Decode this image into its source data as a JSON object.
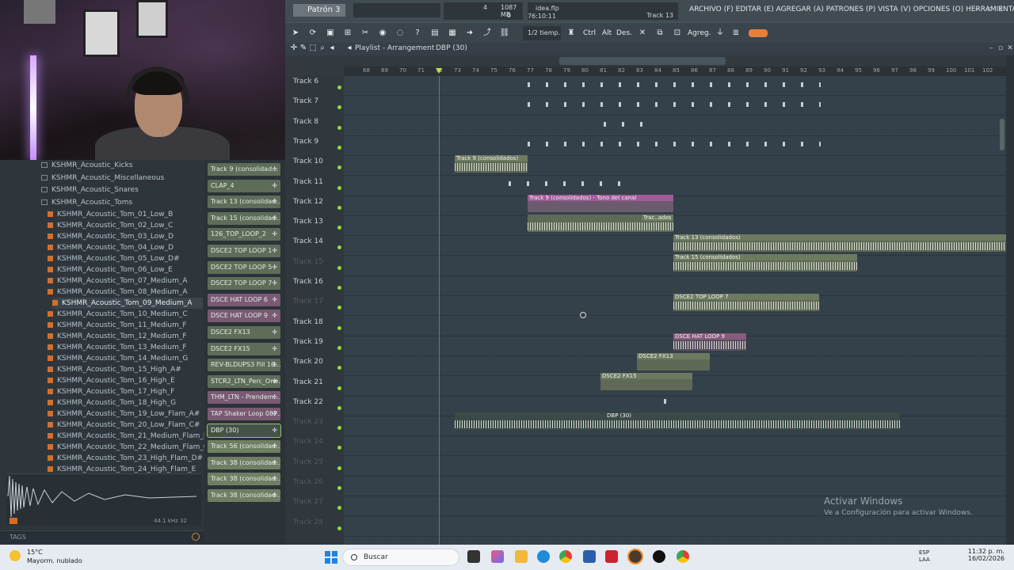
{
  "top": {
    "pattern": "Patrón 3",
    "cpu_num": "4",
    "mem": "1087 MB",
    "poly": "0",
    "hint_title": "idea.flp",
    "hint_time": "76:10:11",
    "hint_track": "Track 13",
    "menu": "ARCHIVO (F) EDITAR (E) AGREGAR (A) PATRONES (P) VISTA (V) OPCIONES (O) HERRAMIENTAS (T) AYUDA"
  },
  "toolbar": {
    "snap": "1/2 tiemp.",
    "ctrl": "Ctrl",
    "alt": "Alt",
    "des": "Des.",
    "agreg": "Agreg."
  },
  "playlist": {
    "title": "Playlist - Arrangement",
    "crumb": "DBP (30)"
  },
  "ruler": [
    "68",
    "69",
    "70",
    "71",
    "72",
    "73",
    "74",
    "75",
    "76",
    "77",
    "78",
    "79",
    "80",
    "81",
    "82",
    "83",
    "84",
    "85",
    "86",
    "87",
    "88",
    "89",
    "90",
    "91",
    "92",
    "93",
    "94",
    "95",
    "96",
    "97",
    "98",
    "99",
    "100",
    "101",
    "102"
  ],
  "tracks": [
    {
      "name": "Track 6",
      "dim": false
    },
    {
      "name": "Track 7",
      "dim": false
    },
    {
      "name": "Track 8",
      "dim": false
    },
    {
      "name": "Track 9",
      "dim": false
    },
    {
      "name": "Track 10",
      "dim": false
    },
    {
      "name": "Track 11",
      "dim": false
    },
    {
      "name": "Track 12",
      "dim": false
    },
    {
      "name": "Track 13",
      "dim": false
    },
    {
      "name": "Track 14",
      "dim": false
    },
    {
      "name": "Track 15",
      "dim": true
    },
    {
      "name": "Track 16",
      "dim": false
    },
    {
      "name": "Track 17",
      "dim": true
    },
    {
      "name": "Track 18",
      "dim": false
    },
    {
      "name": "Track 19",
      "dim": false
    },
    {
      "name": "Track 20",
      "dim": false
    },
    {
      "name": "Track 21",
      "dim": false
    },
    {
      "name": "Track 22",
      "dim": false
    },
    {
      "name": "Track 23",
      "dim": true
    },
    {
      "name": "Track 24",
      "dim": true
    },
    {
      "name": "Track 25",
      "dim": true
    },
    {
      "name": "Track 26",
      "dim": true
    },
    {
      "name": "Track 27",
      "dim": true
    },
    {
      "name": "Track 28",
      "dim": true
    }
  ],
  "clips": {
    "t9": "Track 9 (consolidados)",
    "t11": "Track 9 (consolidados) - Tono del canal",
    "t12": "Trac..ados",
    "t13": "Track 13 (consolidados)",
    "t14": "Track 15 (consolidados)",
    "t16": "DSCE2 TOP LOOP 7",
    "t18": "DSCE HAT LOOP 9",
    "t19": "DSCE2 FX13",
    "t20": "DSCE2 FX15",
    "t22": "DBP (30)"
  },
  "browser": {
    "folders": [
      "KSHMR_Acoustic_Kicks",
      "KSHMR_Acoustic_Miscellaneous",
      "KSHMR_Acoustic_Snares",
      "KSHMR_Acoustic_Toms"
    ],
    "files": [
      "KSHMR_Acoustic_Tom_01_Low_B",
      "KSHMR_Acoustic_Tom_02_Low_C",
      "KSHMR_Acoustic_Tom_03_Low_D",
      "KSHMR_Acoustic_Tom_04_Low_D",
      "KSHMR_Acoustic_Tom_05_Low_D#",
      "KSHMR_Acoustic_Tom_06_Low_E",
      "KSHMR_Acoustic_Tom_07_Medium_A",
      "KSHMR_Acoustic_Tom_08_Medium_A",
      "KSHMR_Acoustic_Tom_09_Medium_A",
      "KSHMR_Acoustic_Tom_10_Medium_C",
      "KSHMR_Acoustic_Tom_11_Medium_F",
      "KSHMR_Acoustic_Tom_12_Medium_F",
      "KSHMR_Acoustic_Tom_13_Medium_F",
      "KSHMR_Acoustic_Tom_14_Medium_G",
      "KSHMR_Acoustic_Tom_15_High_A#",
      "KSHMR_Acoustic_Tom_16_High_E",
      "KSHMR_Acoustic_Tom_17_High_F",
      "KSHMR_Acoustic_Tom_18_High_G",
      "KSHMR_Acoustic_Tom_19_Low_Flam_A#",
      "KSHMR_Acoustic_Tom_20_Low_Flam_C#",
      "KSHMR_Acoustic_Tom_21_Medium_Flam_B",
      "KSHMR_Acoustic_Tom_22_Medium_Flam_C",
      "KSHMR_Acoustic_Tom_23_High_Flam_D#",
      "KSHMR_Acoustic_Tom_24_High_Flam_E"
    ],
    "selected_index": 8,
    "rate": "44.1 kHz 32",
    "tags": "TAGS"
  },
  "picker": [
    {
      "label": "Track 9 (consolidad...",
      "style": "green"
    },
    {
      "label": "CLAP_4",
      "style": "green"
    },
    {
      "label": "Track 13 (consolidad...",
      "style": "green"
    },
    {
      "label": "Track 15 (consolidad...",
      "style": "green"
    },
    {
      "label": "126_TOP_LOOP_2",
      "style": "green"
    },
    {
      "label": "DSCE2 TOP LOOP 1",
      "style": "green"
    },
    {
      "label": "DSCE2 TOP LOOP 5",
      "style": "green"
    },
    {
      "label": "DSCE2 TOP LOOP 7",
      "style": "green"
    },
    {
      "label": "DSCE HAT LOOP 6",
      "style": "purple"
    },
    {
      "label": "DSCE HAT LOOP 9",
      "style": "purple"
    },
    {
      "label": "DSCE2 FX13",
      "style": "green"
    },
    {
      "label": "DSCE2 FX15",
      "style": "green"
    },
    {
      "label": "REV-BLDUPS3 Fill 10...",
      "style": "green"
    },
    {
      "label": "STCR2_LTN_Perc_One...",
      "style": "green"
    },
    {
      "label": "THM_LTN - Prendem...",
      "style": "purple"
    },
    {
      "label": "TAP Shaker Loop 087...",
      "style": "purple"
    },
    {
      "label": "DBP (30)",
      "style": "dark"
    },
    {
      "label": "Track 56 (consolidad...",
      "style": "lgreen"
    },
    {
      "label": "Track 38 (consolidad...",
      "style": "lgreen"
    },
    {
      "label": "Track 38 (consolidad...",
      "style": "lgreen"
    },
    {
      "label": "Track 38 (consolidad...",
      "style": "lgreen"
    }
  ],
  "watermark": {
    "title": "Activar Windows",
    "sub": "Ve a Configuración para activar Windows."
  },
  "taskbar": {
    "temp": "15°C",
    "weather": "Mayorm. nublado",
    "search": "Buscar",
    "lang1": "ESP",
    "lang2": "LAA",
    "time": "11:32 p. m.",
    "date": "16/02/2026"
  }
}
